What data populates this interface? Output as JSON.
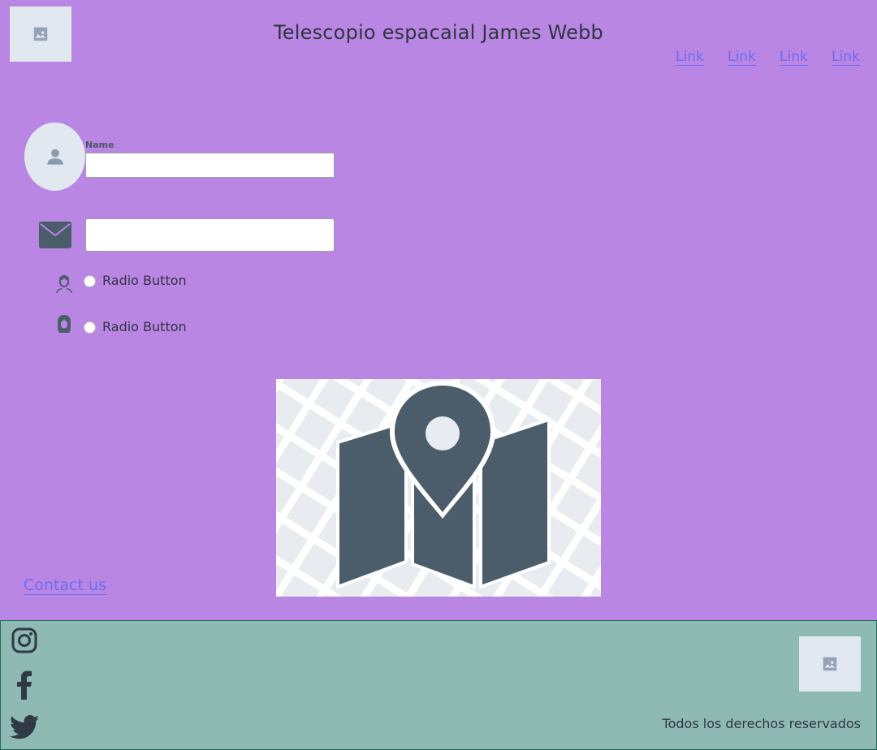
{
  "header": {
    "title": "Telescopio espacaial James Webb",
    "logo_icon": "image-icon",
    "nav": [
      "Link",
      "Link",
      "Link",
      "Link"
    ]
  },
  "form": {
    "avatar_icon": "user-icon",
    "name_label": "Name",
    "name_value": "",
    "email_icon": "envelope-icon",
    "email_value": "",
    "radios": [
      {
        "icon": "male-face-icon",
        "label": "Radio Button",
        "checked": false
      },
      {
        "icon": "female-face-icon",
        "label": "Radio Button",
        "checked": false
      }
    ]
  },
  "map": {
    "icon": "map-pin-icon"
  },
  "contact": {
    "label": "Contact us"
  },
  "footer": {
    "social": [
      "instagram-icon",
      "facebook-icon",
      "twitter-icon"
    ],
    "image_icon": "image-icon",
    "rights": "Todos los derechos reservados"
  },
  "colors": {
    "background": "#b986e3",
    "footer": "#8fbab3",
    "link": "#6a6cf2",
    "icon": "#4b5d6b"
  }
}
